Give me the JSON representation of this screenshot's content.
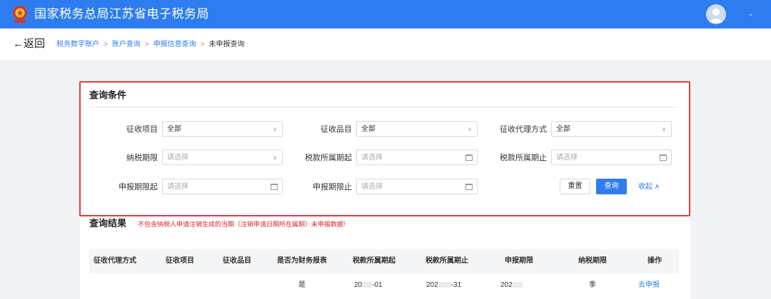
{
  "header": {
    "title": "国家税务总局江苏省电子税务局",
    "brand_color": "#2e7df0",
    "logo_icon": "tax-emblem-icon",
    "avatar_icon": "user-avatar-icon",
    "menu_icon": "chevron-down-icon",
    "menu_glyph": "⌄"
  },
  "breadcrumb": {
    "back_label": "←返回",
    "items": [
      "税务数字账户",
      "账户查询",
      "申报信息查询"
    ],
    "current": "未申报查询",
    "separator": ">"
  },
  "query": {
    "title": "查询条件",
    "fields": {
      "collection_item": {
        "label": "征收项目",
        "value": "全部"
      },
      "collection_subitem": {
        "label": "征收品目",
        "value": "全部"
      },
      "agent_method": {
        "label": "征收代理方式",
        "value": "全部"
      },
      "tax_period": {
        "label": "纳税期限",
        "placeholder": "请选择"
      },
      "period_start": {
        "label": "税款所属期起",
        "placeholder": "请选择"
      },
      "period_end": {
        "label": "税款所属期止",
        "placeholder": "请选择"
      },
      "filing_start": {
        "label": "申报期限起",
        "placeholder": "请选择"
      },
      "filing_end": {
        "label": "申报期限止",
        "placeholder": "请选择"
      }
    },
    "reset_label": "重置",
    "submit_label": "查询",
    "collapse_label": "收起 ∧",
    "dropdown_glyph": "∨",
    "highlight_color": "#e23b3b"
  },
  "results": {
    "title": "查询结果",
    "warning": "不包含纳税人申请注销生成的当期（注销申请日期所在属期）未申报数据!",
    "columns": [
      "征收代理方式",
      "征收项目",
      "征收品目",
      "是否为财务报表",
      "税款所属期起",
      "税款所属期止",
      "申报期限",
      "纳税期限",
      "操作"
    ],
    "rows": [
      {
        "is_financial": "是",
        "period_start_a": "20",
        "period_start_b": "-01",
        "period_end_a": "202",
        "period_end_b": "-31",
        "deadline": "202",
        "tax_period": "季",
        "action": "去申报"
      }
    ]
  }
}
